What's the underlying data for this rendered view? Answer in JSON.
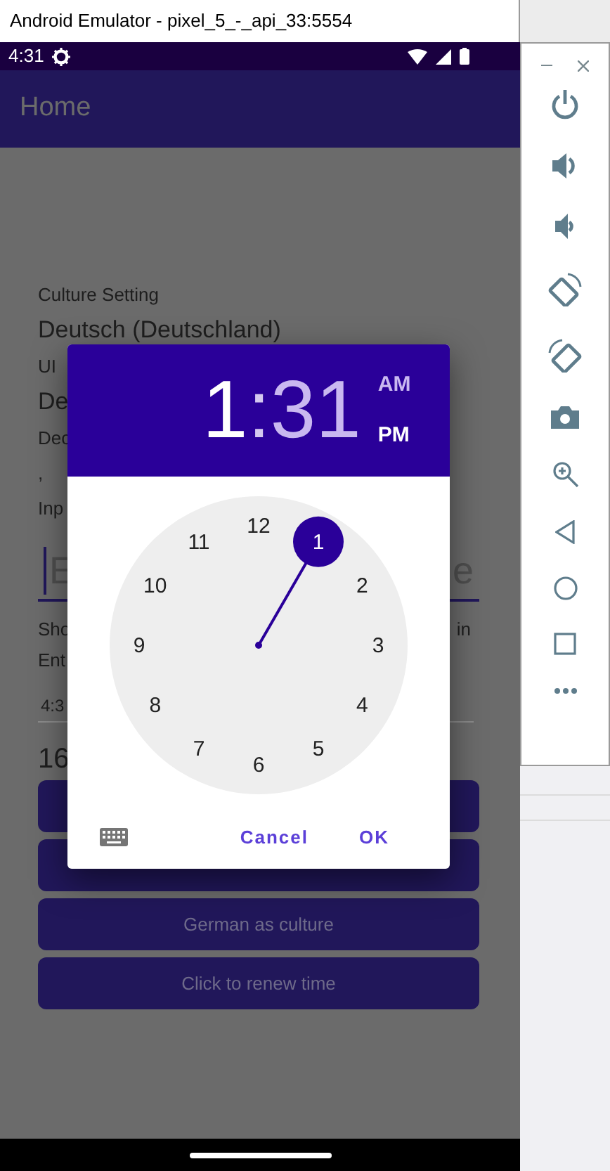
{
  "window": {
    "title": "Android Emulator - pixel_5_-_api_33:5554"
  },
  "status_bar": {
    "time": "4:31"
  },
  "app_bar": {
    "title": "Home"
  },
  "content": [
    {
      "kind": "label",
      "text": "Culture Setting"
    },
    {
      "kind": "value",
      "text": "Deutsch (Deutschland)"
    },
    {
      "kind": "label",
      "text": "UI"
    },
    {
      "kind": "value",
      "text": "De"
    },
    {
      "kind": "label",
      "text": "Dec"
    },
    {
      "kind": "label",
      "text": ","
    },
    {
      "kind": "label",
      "text": "Inp"
    },
    {
      "kind": "entry",
      "placeholder_start": "E",
      "placeholder_end": "e"
    },
    {
      "kind": "split",
      "start": "Sho",
      "end": "in"
    },
    {
      "kind": "label",
      "text": "Ent"
    },
    {
      "kind": "time_field",
      "value": "4:3"
    },
    {
      "kind": "big",
      "text": "16"
    },
    {
      "kind": "button"
    },
    {
      "kind": "button"
    },
    {
      "kind": "button",
      "label": "German as culture"
    },
    {
      "kind": "button",
      "label": "Click to renew time"
    }
  ],
  "time_picker": {
    "hour": "1",
    "separator": ":",
    "minute": "31",
    "periods": [
      {
        "label": "AM",
        "selected": false
      },
      {
        "label": "PM",
        "selected": true
      }
    ],
    "dial": [
      {
        "label": "12",
        "selected": false
      },
      {
        "label": "1",
        "selected": true
      },
      {
        "label": "2",
        "selected": false
      },
      {
        "label": "3",
        "selected": false
      },
      {
        "label": "4",
        "selected": false
      },
      {
        "label": "5",
        "selected": false
      },
      {
        "label": "6",
        "selected": false
      },
      {
        "label": "7",
        "selected": false
      },
      {
        "label": "8",
        "selected": false
      },
      {
        "label": "9",
        "selected": false
      },
      {
        "label": "10",
        "selected": false
      },
      {
        "label": "11",
        "selected": false
      }
    ],
    "buttons": [
      "Cancel",
      "OK"
    ]
  }
}
